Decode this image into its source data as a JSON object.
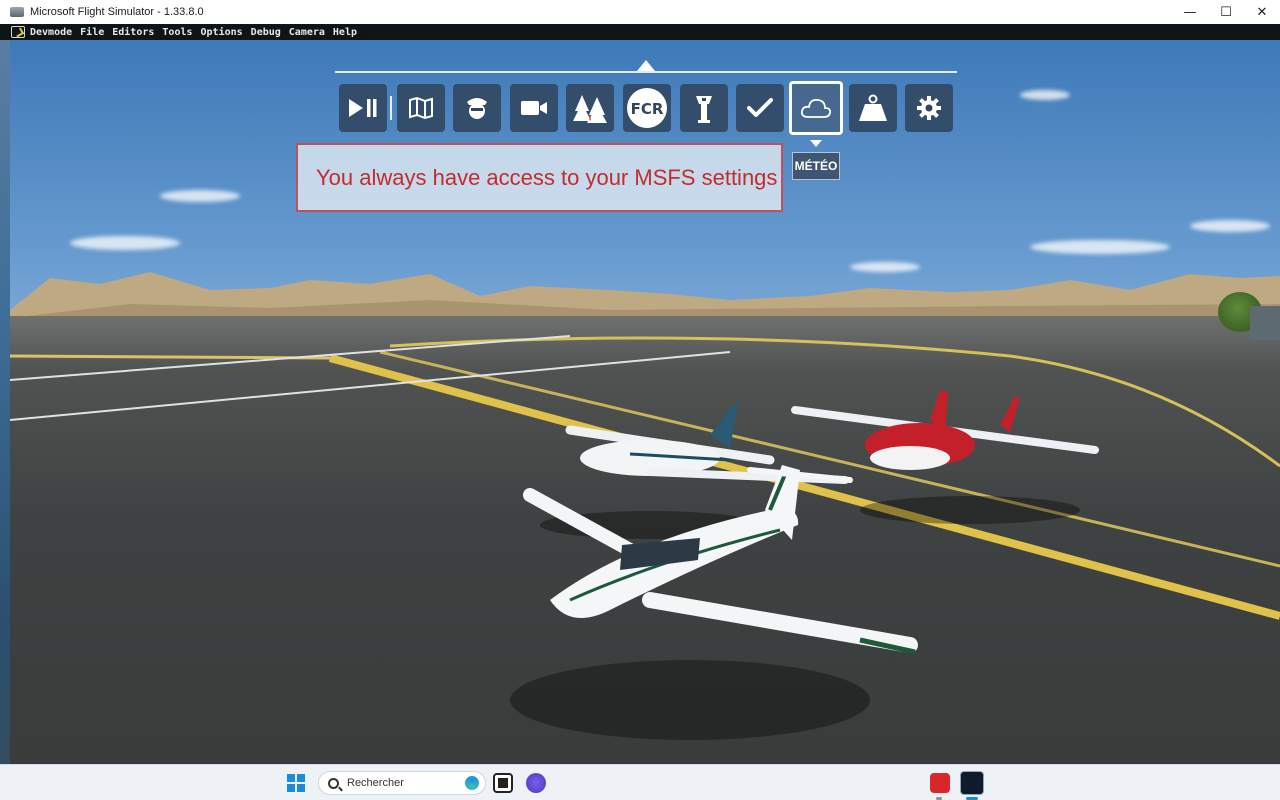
{
  "window": {
    "title": "Microsoft Flight Simulator - 1.33.8.0",
    "minimize_glyph": "—",
    "maximize_glyph": "☐",
    "close_glyph": "✕"
  },
  "menubar": {
    "items": [
      "Devmode",
      "File",
      "Editors",
      "Tools",
      "Options",
      "Debug",
      "Camera",
      "Help"
    ]
  },
  "toolbar": {
    "tools": [
      {
        "icon": "play-pause-icon"
      },
      {
        "icon": "map-icon"
      },
      {
        "icon": "pilot-icon"
      },
      {
        "icon": "camera-icon"
      },
      {
        "icon": "trees-icon"
      },
      {
        "icon": "fcr-icon",
        "label": "FCR"
      },
      {
        "icon": "atc-tower-icon"
      },
      {
        "icon": "checklist-icon"
      },
      {
        "icon": "cloud-icon",
        "selected": true
      },
      {
        "icon": "weight-icon"
      },
      {
        "icon": "gear-icon"
      }
    ],
    "tooltip": "MÉTÉO"
  },
  "annotation": {
    "text": "You always have access to your MSFS settings",
    "color": "#c22c2c"
  },
  "taskbar": {
    "search_placeholder": "Rechercher",
    "accent": "#1a8cdc"
  }
}
